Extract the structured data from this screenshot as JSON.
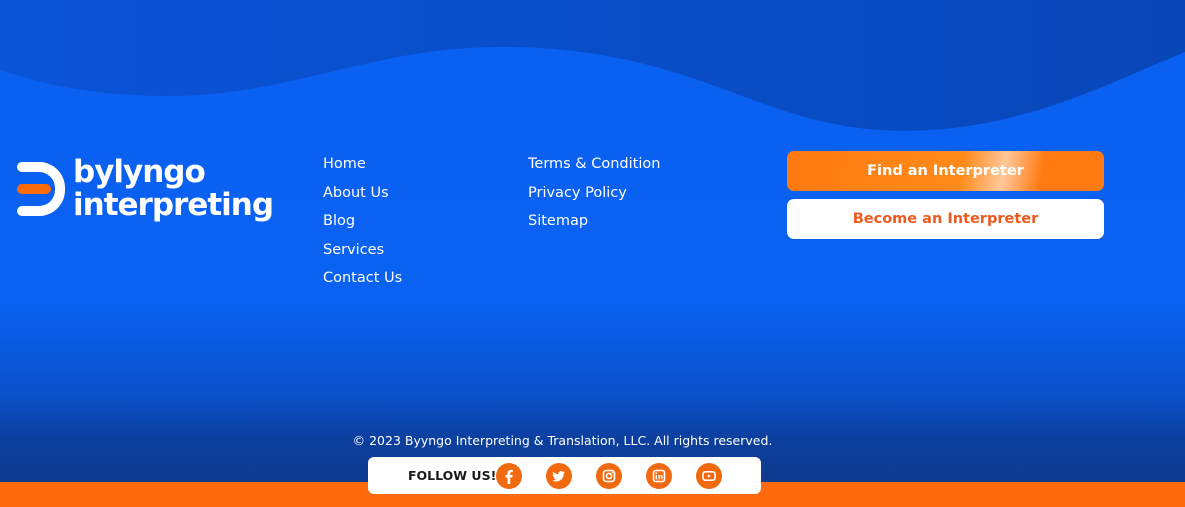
{
  "brand": {
    "line1": "bylyngo",
    "line2": "interpreting",
    "colors": {
      "orange": "#ff6a0d",
      "blue": "#0a62f2",
      "white": "#ffffff"
    }
  },
  "nav_col1": [
    "Home",
    "About Us",
    "Blog",
    "Services",
    "Contact Us"
  ],
  "nav_col2": [
    "Terms & Condition",
    "Privacy Policy",
    "Sitemap"
  ],
  "buttons": {
    "find": "Find an Interpreter",
    "become": "Become an Interpreter"
  },
  "footer": {
    "copyright": "© 2023 Byyngo Interpreting & Translation, LLC. All rights reserved.",
    "follow_label": "FOLLOW US!",
    "social_icons": [
      "facebook-icon",
      "twitter-icon",
      "instagram-icon",
      "linkedin-icon",
      "youtube-icon"
    ]
  }
}
